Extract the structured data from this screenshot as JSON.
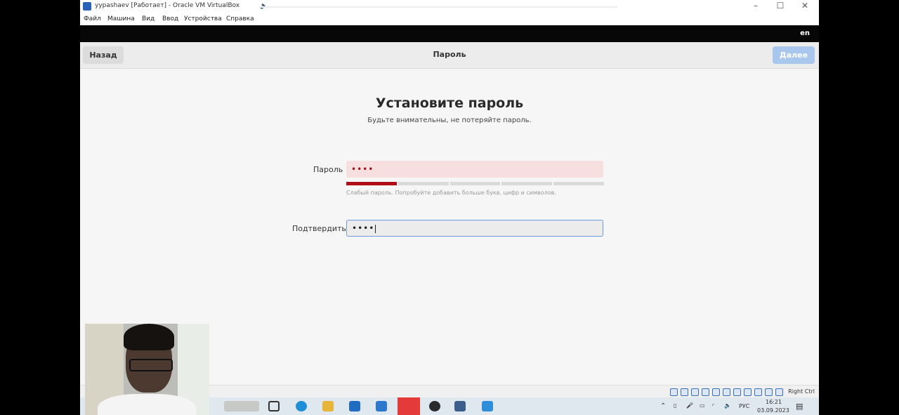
{
  "window": {
    "title": "yypashaev [Работает] - Oracle VM VirtualBox",
    "menu": [
      "Файл",
      "Машина",
      "Вид",
      "Ввод",
      "Устройства",
      "Справка"
    ]
  },
  "gnome_topbar": {
    "lang": "en"
  },
  "header": {
    "back_label": "Назад",
    "title": "Пароль",
    "next_label": "Далее"
  },
  "page": {
    "heading": "Установите пароль",
    "subheading": "Будьте внимательны, не потеряйте пароль."
  },
  "password": {
    "label": "Пароль",
    "masked_value": "••••",
    "strength_segments_filled": 1,
    "strength_segments_total": 5,
    "hint": "Слабый пароль. Попробуйте добавить больше букв, цифр и символов."
  },
  "confirm": {
    "label": "Подтвердить",
    "masked_value": "••••"
  },
  "statusbar": {
    "host_key": "Right Ctrl"
  },
  "taskbar": {
    "apps": [
      "task-view-icon",
      "edge-icon",
      "file-explorer-icon",
      "store-icon",
      "mail-icon",
      "opera-icon",
      "game-icon",
      "virtualbox-icon",
      "photos-icon"
    ],
    "lang": "РУС",
    "time": "16:21",
    "date": "03.09.2023"
  },
  "colors": {
    "accent": "#a9c6ec",
    "weak": "#b10f17",
    "error_bg": "#f7dedf"
  }
}
